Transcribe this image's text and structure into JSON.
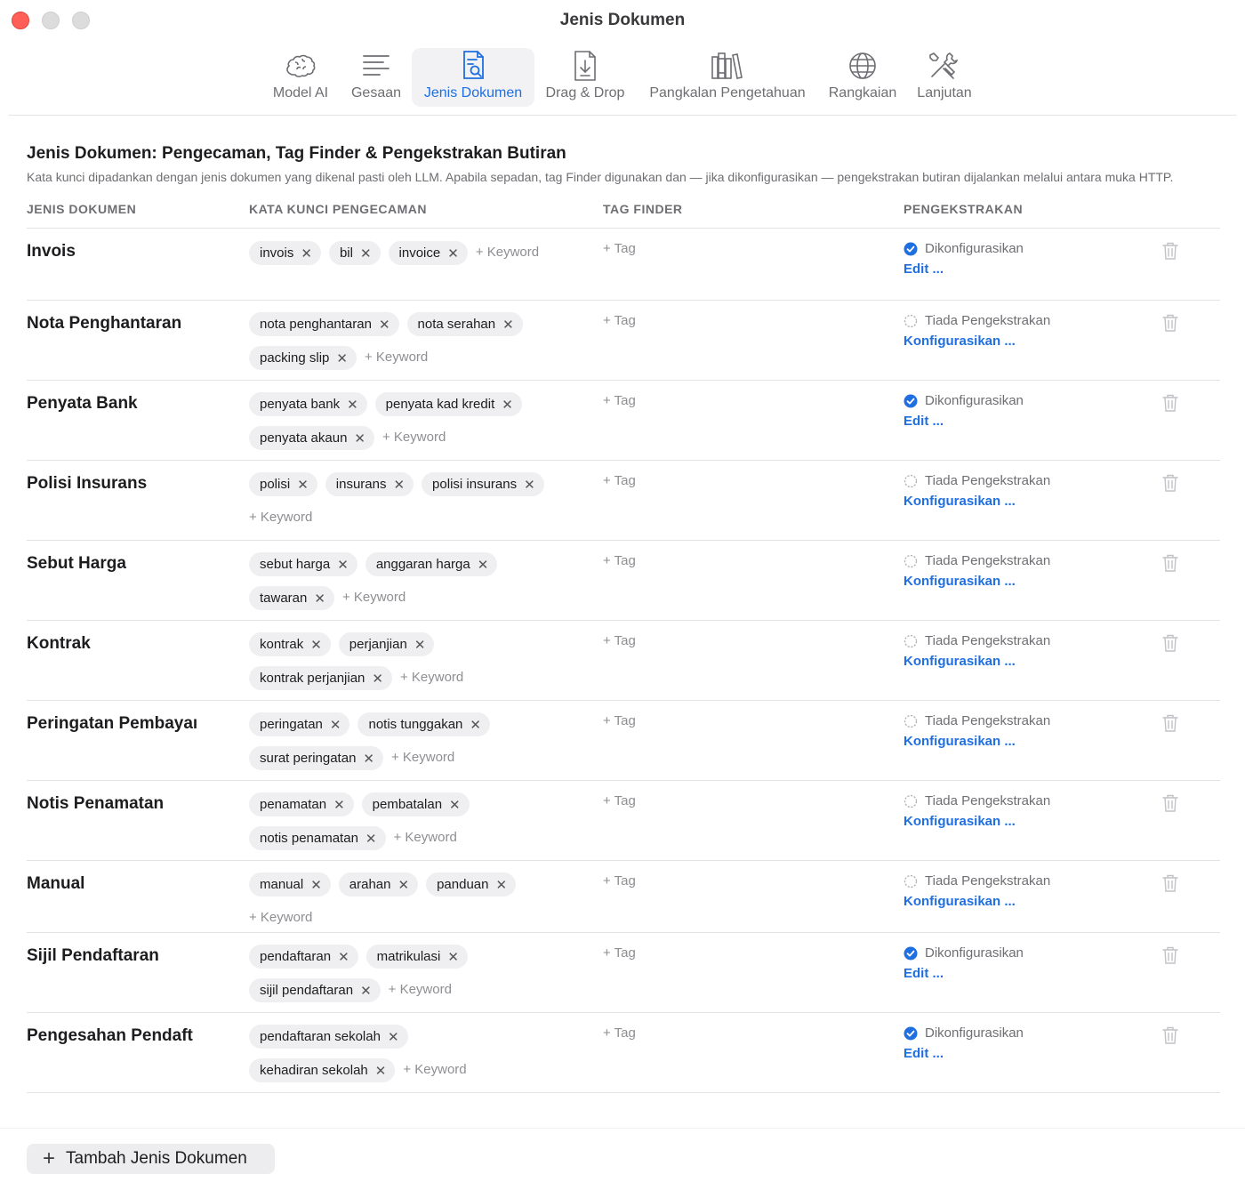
{
  "window": {
    "title": "Jenis Dokumen"
  },
  "toolbar": {
    "items": [
      {
        "label": "Model AI",
        "icon": "brain-icon"
      },
      {
        "label": "Gesaan",
        "icon": "text-lines-icon"
      },
      {
        "label": "Jenis Dokumen",
        "icon": "document-search-icon",
        "active": true
      },
      {
        "label": "Drag & Drop",
        "icon": "document-download-icon"
      },
      {
        "label": "Pangkalan Pengetahuan",
        "icon": "books-icon"
      },
      {
        "label": "Rangkaian",
        "icon": "globe-icon"
      },
      {
        "label": "Lanjutan",
        "icon": "tools-icon"
      }
    ]
  },
  "main": {
    "heading": "Jenis Dokumen: Pengecaman, Tag Finder & Pengekstrakan Butiran",
    "description": "Kata kunci dipadankan dengan jenis dokumen yang dikenal pasti oleh LLM. Apabila sepadan, tag Finder digunakan dan — jika dikonfigurasikan — pengekstrakan butiran dijalankan melalui antara muka HTTP.",
    "columns": {
      "type": "JENIS DOKUMEN",
      "keywords": "KATA KUNCI PENGECAMAN",
      "tags": "TAG FINDER",
      "extraction": "PENGEKSTRAKAN"
    },
    "add_keyword_label": "+ Keyword",
    "add_tag_label": "+ Tag",
    "configured_label": "Dikonfigurasikan",
    "not_configured_label": "Tiada Pengekstrakan",
    "edit_label": "Edit ...",
    "configure_label": "Konfigurasikan ...",
    "colors": {
      "accent": "#1f6fe0",
      "chip_bg": "#efeff1",
      "close": "#ff5f57"
    },
    "rows": [
      {
        "name": "Invois",
        "keywords": [
          "invois",
          "bil",
          "invoice"
        ],
        "configured": true
      },
      {
        "name": "Nota Penghantaran",
        "keywords": [
          "nota penghantaran",
          "nota serahan",
          "packing slip"
        ],
        "configured": false
      },
      {
        "name": "Penyata Bank",
        "keywords": [
          "penyata bank",
          "penyata kad kredit",
          "penyata akaun"
        ],
        "configured": true
      },
      {
        "name": "Polisi Insurans",
        "keywords": [
          "polisi",
          "insurans",
          "polisi insurans"
        ],
        "configured": false
      },
      {
        "name": "Sebut Harga",
        "keywords": [
          "sebut harga",
          "anggaran harga",
          "tawaran"
        ],
        "configured": false
      },
      {
        "name": "Kontrak",
        "keywords": [
          "kontrak",
          "perjanjian",
          "kontrak perjanjian"
        ],
        "configured": false
      },
      {
        "name": "Peringatan Pembayaı",
        "keywords": [
          "peringatan",
          "notis tunggakan",
          "surat peringatan"
        ],
        "configured": false
      },
      {
        "name": "Notis Penamatan",
        "keywords": [
          "penamatan",
          "pembatalan",
          "notis penamatan"
        ],
        "configured": false
      },
      {
        "name": "Manual",
        "keywords": [
          "manual",
          "arahan",
          "panduan"
        ],
        "configured": false
      },
      {
        "name": "Sijil Pendaftaran",
        "keywords": [
          "pendaftaran",
          "matrikulasi",
          "sijil pendaftaran"
        ],
        "configured": true
      },
      {
        "name": "Pengesahan Pendaft",
        "keywords": [
          "pendaftaran sekolah",
          "kehadiran sekolah"
        ],
        "configured": true
      }
    ]
  },
  "footer": {
    "add_button_label": "Tambah Jenis Dokumen"
  }
}
